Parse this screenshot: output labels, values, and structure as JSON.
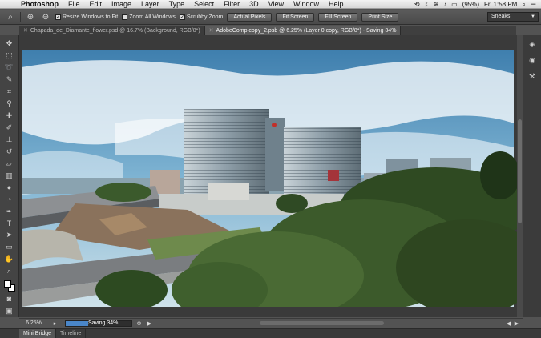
{
  "menubar": {
    "app_name": "Photoshop",
    "items": [
      "File",
      "Edit",
      "Image",
      "Layer",
      "Type",
      "Select",
      "Filter",
      "3D",
      "View",
      "Window",
      "Help"
    ],
    "battery": "(95%)",
    "clock": "Fri 1:58 PM"
  },
  "options_bar": {
    "resize_windows": "Resize Windows to Fit",
    "zoom_all_windows": "Zoom All Windows",
    "scrubby_zoom": "Scrubby Zoom",
    "actual_pixels": "Actual Pixels",
    "fit_screen": "Fit Screen",
    "fill_screen": "Fill Screen",
    "print_size": "Print Size",
    "workspace": "Sneaks"
  },
  "tabs": [
    {
      "label": "Chapada_de_Diamante_flower.psd @ 16.7% (Background, RGB/8*)"
    },
    {
      "label": "AdobeComp copy_2.psb @ 6.25% (Layer 0 copy, RGB/8*) - Saving 34%"
    }
  ],
  "status": {
    "zoom": "6.25%",
    "progress_label": "Saving 34%",
    "progress_fraction": 0.34
  },
  "bottom_tabs": [
    "Mini Bridge",
    "Timeline"
  ],
  "colors": {
    "accent": "#4a86c8",
    "panel": "#535353",
    "dark": "#3a3a3a"
  }
}
